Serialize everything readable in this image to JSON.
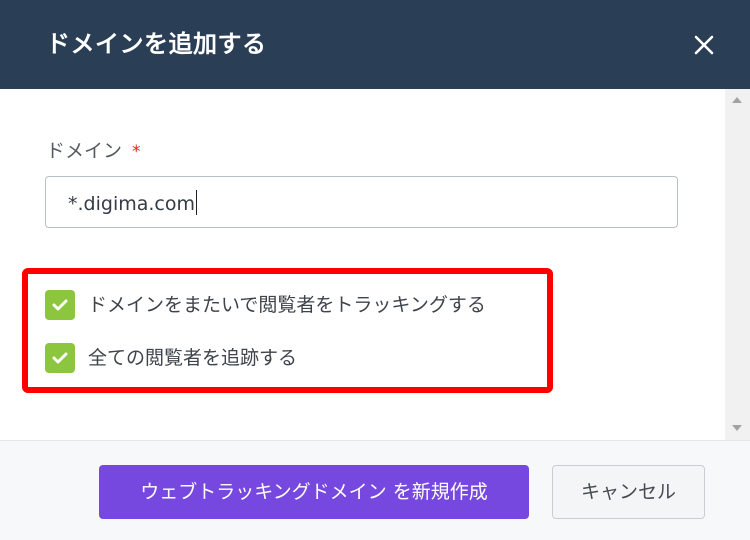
{
  "dialog": {
    "title": "ドメインを追加する",
    "close_icon": "close-icon"
  },
  "form": {
    "domain_label": "ドメイン",
    "required_mark": "*",
    "domain_value": "*.digima.com"
  },
  "options": [
    {
      "label": "ドメインをまたいで閲覧者をトラッキングする",
      "checked": true
    },
    {
      "label": "全ての閲覧者を追跡する",
      "checked": true
    }
  ],
  "footer": {
    "create_label": "ウェブトラッキングドメイン を新規作成",
    "cancel_label": "キャンセル"
  },
  "colors": {
    "header_bg": "#2a3f55",
    "checkbox_green": "#8cc63f",
    "primary_purple": "#7748e0",
    "highlight_red": "#ff0000",
    "required_red": "#e02020"
  }
}
